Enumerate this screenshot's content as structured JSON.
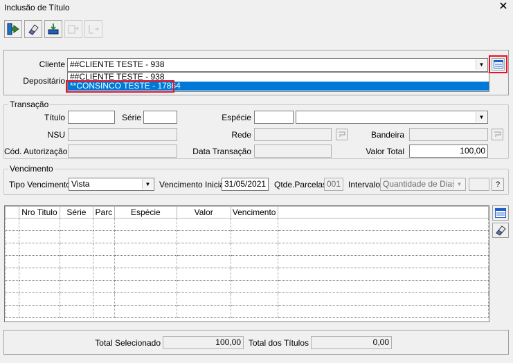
{
  "window": {
    "title": "Inclusão de Título",
    "close": "✕"
  },
  "toolbar": [
    {
      "name": "exit-icon",
      "enabled": true
    },
    {
      "name": "eraser-icon",
      "enabled": true
    },
    {
      "name": "save-icon",
      "enabled": true
    },
    {
      "name": "copy-disabled-icon",
      "enabled": false
    },
    {
      "name": "paste-disabled-icon",
      "enabled": false
    }
  ],
  "cliente": {
    "label": "Cliente",
    "value": "##CLIENTE TESTE - 938",
    "options": [
      "##CLIENTE TESTE - 938",
      "**CONSINCO TESTE - 17864"
    ],
    "selected_option": "**CONSINCO TESTE - 17864"
  },
  "depositario": {
    "label": "Depositário"
  },
  "transacao": {
    "legend": "Transação",
    "titulo_label": "Título",
    "titulo_value": "",
    "serie_label": "Série",
    "serie_value": "",
    "especie_label": "Espécie",
    "especie_value": "",
    "especie_desc": "",
    "nsu_label": "NSU",
    "nsu_value": "",
    "rede_label": "Rede",
    "rede_value": "",
    "bandeira_label": "Bandeira",
    "bandeira_value": "",
    "cod_aut_label": "Cód. Autorização",
    "cod_aut_value": "",
    "data_trans_label": "Data Transação",
    "data_trans_value": "",
    "valor_total_label": "Valor Total",
    "valor_total_value": "100,00"
  },
  "vencimento": {
    "legend": "Vencimento",
    "tipo_label": "Tipo Vencimento",
    "tipo_value": "Vista",
    "inicial_label": "Vencimento Inicial",
    "inicial_value": "31/05/2021",
    "parcelas_label": "Qtde.Parcelas",
    "parcelas_value": "001",
    "intervalo_label": "Intervalo",
    "intervalo_value": "Quantidade de Dias",
    "help_label": "?"
  },
  "grid": {
    "columns": [
      "",
      "Nro Titulo",
      "Série",
      "Parc",
      "Espécie",
      "Valor",
      "Vencimento",
      ""
    ],
    "empty_rows": 8
  },
  "footer": {
    "total_sel_label": "Total Selecionado",
    "total_sel_value": "100,00",
    "total_tit_label": "Total dos Títulos",
    "total_tit_value": "0,00"
  },
  "colors": {
    "highlight": "#e81123",
    "selection": "#0078d7"
  }
}
